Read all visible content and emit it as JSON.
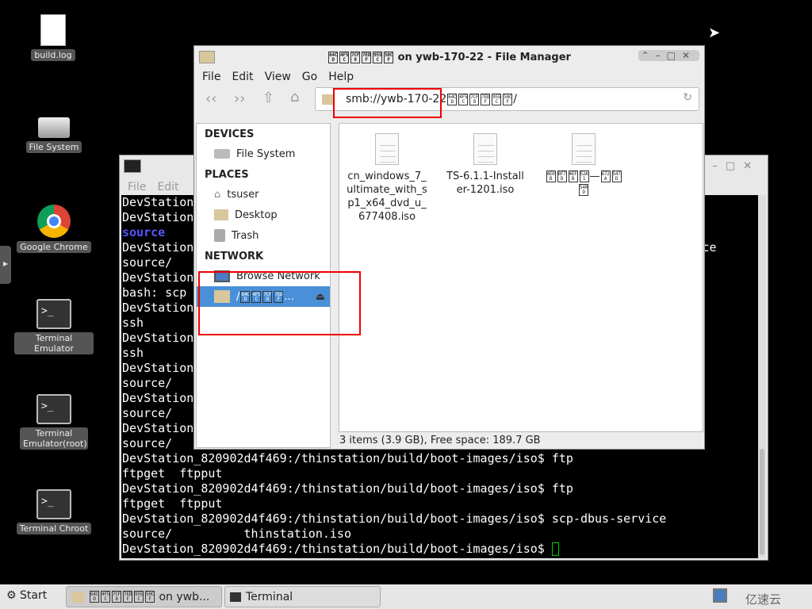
{
  "desktop": {
    "icons": [
      "build.log",
      "File System",
      "Google Chrome",
      "Terminal Emulator",
      "Terminal Emulator(root)",
      "Terminal Chroot"
    ]
  },
  "terminal": {
    "menu": [
      "File",
      "Edit"
    ],
    "lines": [
      {
        "t": "DevStation_820902d4f469:/thinstation/build/boot-images/iso$ scp"
      },
      {
        "t": "DevStation_820902d4f469:/thinstation/build/boot-images/iso$ ls"
      },
      {
        "t": "source",
        "c": "#5555ff"
      },
      {
        "t": "DevStation_820902d4f469:/thinstation/build/boot-images/iso$ scp -r source/ root@.ce"
      },
      {
        "t": "source/"
      },
      {
        "t": "DevStation_820902d4f469:/thinstation/build/boot-images/iso$ scp"
      },
      {
        "t": "bash: scp"
      },
      {
        "t": "DevStation_820902d4f469:/thinstation/build/boot-images/iso$ ss"
      },
      {
        "t": "ssh"
      },
      {
        "t": "DevStation_820902d4f469:/thinstation/build/boot-images/iso$ ss"
      },
      {
        "t": "ssh"
      },
      {
        "t": "DevStation_820902d4f469:/thinstation/build/boot-images/iso$ so"
      },
      {
        "t": "source/"
      },
      {
        "t": "DevStation_820902d4f469:/thinstation/build/boot-images/iso$ so"
      },
      {
        "t": "source/"
      },
      {
        "t": "DevStation_820902d4f469:/thinstation/build/boot-images/iso$ so"
      },
      {
        "t": "source/"
      },
      {
        "t": "DevStation_820902d4f469:/thinstation/build/boot-images/iso$ ftp"
      },
      {
        "t": "ftpget  ftpput"
      },
      {
        "t": "DevStation_820902d4f469:/thinstation/build/boot-images/iso$ ftp"
      },
      {
        "t": "ftpget  ftpput"
      },
      {
        "t": "DevStation_820902d4f469:/thinstation/build/boot-images/iso$ scp-dbus-service"
      },
      {
        "t": "source/          thinstation.iso"
      },
      {
        "t": "DevStation_820902d4f469:/thinstation/build/boot-images/iso$ "
      }
    ]
  },
  "fm": {
    "title_codes": [
      "64CD",
      "4F5C",
      "7CF8",
      "7EDF",
      "955C",
      "50CF"
    ],
    "title_suffix": " on ywb-170-22 - File Manager",
    "menu": [
      "File",
      "Edit",
      "View",
      "Go",
      "Help"
    ],
    "path_prefix": "smb://ywb-170-22",
    "path_suffix": "/",
    "sections": {
      "devices": "DEVICES",
      "places": "PLACES",
      "network": "NETWORK"
    },
    "devices": [
      "File System"
    ],
    "places": [
      "tsuser",
      "Desktop",
      "Trash"
    ],
    "network": [
      "Browse Network"
    ],
    "share_prefix": "/",
    "share_suffix": "...",
    "files": [
      {
        "name": "cn_windows_7_ultimate_with_sp1_x64_dvd_u_677408.iso"
      },
      {
        "name": "TS-6.1.1-Installer-1201.iso"
      },
      {
        "codes": [
          "4E0B",
          "8F7D",
          "4EFB",
          "52A1",
          "—",
          "672A",
          "547D",
          "540D"
        ]
      }
    ],
    "status": "3 items (3.9 GB), Free space: 189.7 GB"
  },
  "taskbar": {
    "start": "Start",
    "fm_suffix": " on ywb...",
    "terminal": "Terminal",
    "watermark": "亿速云"
  }
}
